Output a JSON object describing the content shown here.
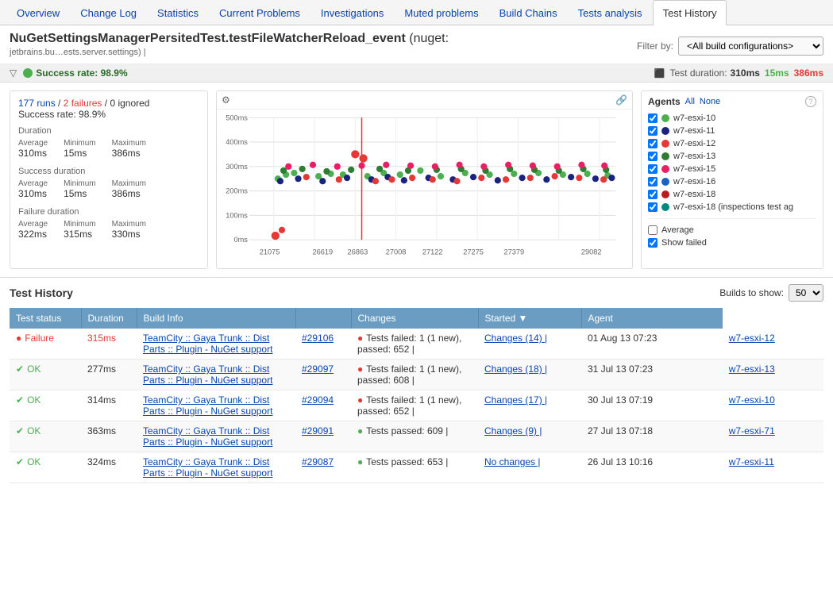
{
  "nav": {
    "tabs": [
      {
        "id": "overview",
        "label": "Overview",
        "active": false
      },
      {
        "id": "changelog",
        "label": "Change Log",
        "active": false
      },
      {
        "id": "statistics",
        "label": "Statistics",
        "active": false
      },
      {
        "id": "current-problems",
        "label": "Current Problems",
        "active": false
      },
      {
        "id": "investigations",
        "label": "Investigations",
        "active": false
      },
      {
        "id": "muted-problems",
        "label": "Muted problems",
        "active": false
      },
      {
        "id": "build-chains",
        "label": "Build Chains",
        "active": false
      },
      {
        "id": "tests-analysis",
        "label": "Tests analysis",
        "active": false
      },
      {
        "id": "test-history",
        "label": "Test History",
        "active": true
      }
    ]
  },
  "header": {
    "title_bold": "NuGetSettingsManagerPersitedTest.testFileWatcherReload_event",
    "title_normal": " (nuget:",
    "subtitle": "jetbrains.bu…ests.server.settings) |",
    "filter_label": "Filter by:",
    "filter_value": "<All build configurations>",
    "filter_options": [
      "<All build configurations>"
    ]
  },
  "summary_bar": {
    "success_dot_color": "#4caf50",
    "success_text": "Success rate: 98.9%",
    "duration_label": "Test duration:",
    "duration_avg": "310ms",
    "duration_min": "15ms",
    "duration_max": "386ms"
  },
  "left_panel": {
    "runs": "177 runs",
    "failures": "2 failures",
    "ignored": "0 ignored",
    "success_rate": "Success rate: 98.9%",
    "duration_title": "Duration",
    "duration_avg_label": "Average",
    "duration_avg": "310ms",
    "duration_min_label": "Minimum",
    "duration_min": "15ms",
    "duration_max_label": "Maximum",
    "duration_max": "386ms",
    "success_dur_title": "Success duration",
    "success_avg": "310ms",
    "success_min": "15ms",
    "success_max": "386ms",
    "failure_dur_title": "Failure duration",
    "failure_avg": "322ms",
    "failure_min": "315ms",
    "failure_max": "330ms"
  },
  "chart": {
    "y_labels": [
      "500ms",
      "400ms",
      "300ms",
      "200ms",
      "100ms",
      "0ms"
    ],
    "x_labels": [
      "21075",
      "26619",
      "26863",
      "27008",
      "27122",
      "27275",
      "27379",
      "29082"
    ]
  },
  "agents": {
    "title": "Agents",
    "all_label": "All",
    "none_label": "None",
    "items": [
      {
        "name": "w7-esxi-10",
        "color": "#4caf50",
        "checked": true
      },
      {
        "name": "w7-esxi-11",
        "color": "#1a237e",
        "checked": true
      },
      {
        "name": "w7-esxi-12",
        "color": "#e53935",
        "checked": true
      },
      {
        "name": "w7-esxi-13",
        "color": "#2e7d32",
        "checked": true
      },
      {
        "name": "w7-esxi-15",
        "color": "#e91e63",
        "checked": true
      },
      {
        "name": "w7-esxi-16",
        "color": "#1565c0",
        "checked": true
      },
      {
        "name": "w7-esxi-18",
        "color": "#b71c1c",
        "checked": true
      },
      {
        "name": "w7-esxi-18 (inspections test ag",
        "color": "#00897b",
        "checked": true
      }
    ],
    "average_label": "Average",
    "average_checked": false,
    "show_failed_label": "Show failed",
    "show_failed_checked": true
  },
  "test_history": {
    "title": "Test History",
    "builds_to_show_label": "Builds to show:",
    "builds_to_show_value": "50",
    "columns": [
      "Test status",
      "Duration",
      "Build Info",
      "",
      "Changes",
      "Started ▼",
      "Agent"
    ],
    "rows": [
      {
        "status": "Failure",
        "status_type": "failure",
        "duration": "315ms",
        "duration_type": "failure",
        "build_path": "TeamCity :: Gaya Trunk :: Dist Parts :: Plugin - NuGet support",
        "build_num": "#29106",
        "test_result": "Tests failed: 1 (1 new), passed: 652 |",
        "test_result_type": "failure",
        "changes": "Changes (14) |",
        "started": "01 Aug 13 07:23",
        "agent": "w7-esxi-12"
      },
      {
        "status": "OK",
        "status_type": "ok",
        "duration": "277ms",
        "duration_type": "ok",
        "build_path": "TeamCity :: Gaya Trunk :: Dist Parts :: Plugin - NuGet support",
        "build_num": "#29097",
        "test_result": "Tests failed: 1 (1 new), passed: 608 |",
        "test_result_type": "failure",
        "changes": "Changes (18) |",
        "started": "31 Jul 13 07:23",
        "agent": "w7-esxi-13"
      },
      {
        "status": "OK",
        "status_type": "ok",
        "duration": "314ms",
        "duration_type": "ok",
        "build_path": "TeamCity :: Gaya Trunk :: Dist Parts :: Plugin - NuGet support",
        "build_num": "#29094",
        "test_result": "Tests failed: 1 (1 new), passed: 652 |",
        "test_result_type": "failure",
        "changes": "Changes (17) |",
        "started": "30 Jul 13 07:19",
        "agent": "w7-esxi-10"
      },
      {
        "status": "OK",
        "status_type": "ok",
        "duration": "363ms",
        "duration_type": "ok",
        "build_path": "TeamCity :: Gaya Trunk :: Dist Parts :: Plugin - NuGet support",
        "build_num": "#29091",
        "test_result": "Tests passed: 609 |",
        "test_result_type": "success",
        "changes": "Changes (9) |",
        "started": "27 Jul 13 07:18",
        "agent": "w7-esxi-71"
      },
      {
        "status": "OK",
        "status_type": "ok",
        "duration": "324ms",
        "duration_type": "ok",
        "build_path": "TeamCity :: Gaya Trunk :: Dist Parts :: Plugin - NuGet support",
        "build_num": "#29087",
        "test_result": "Tests passed: 653 |",
        "test_result_type": "success",
        "changes": "No changes |",
        "started": "26 Jul 13 10:16",
        "agent": "w7-esxi-11"
      }
    ]
  },
  "icons": {
    "collapse": "▽",
    "expand": "▶",
    "settings": "⚙",
    "export": "⬆",
    "mute": "♪",
    "checkmark": "✔",
    "failure_circle": "●",
    "help": "?",
    "link": "|◇"
  }
}
